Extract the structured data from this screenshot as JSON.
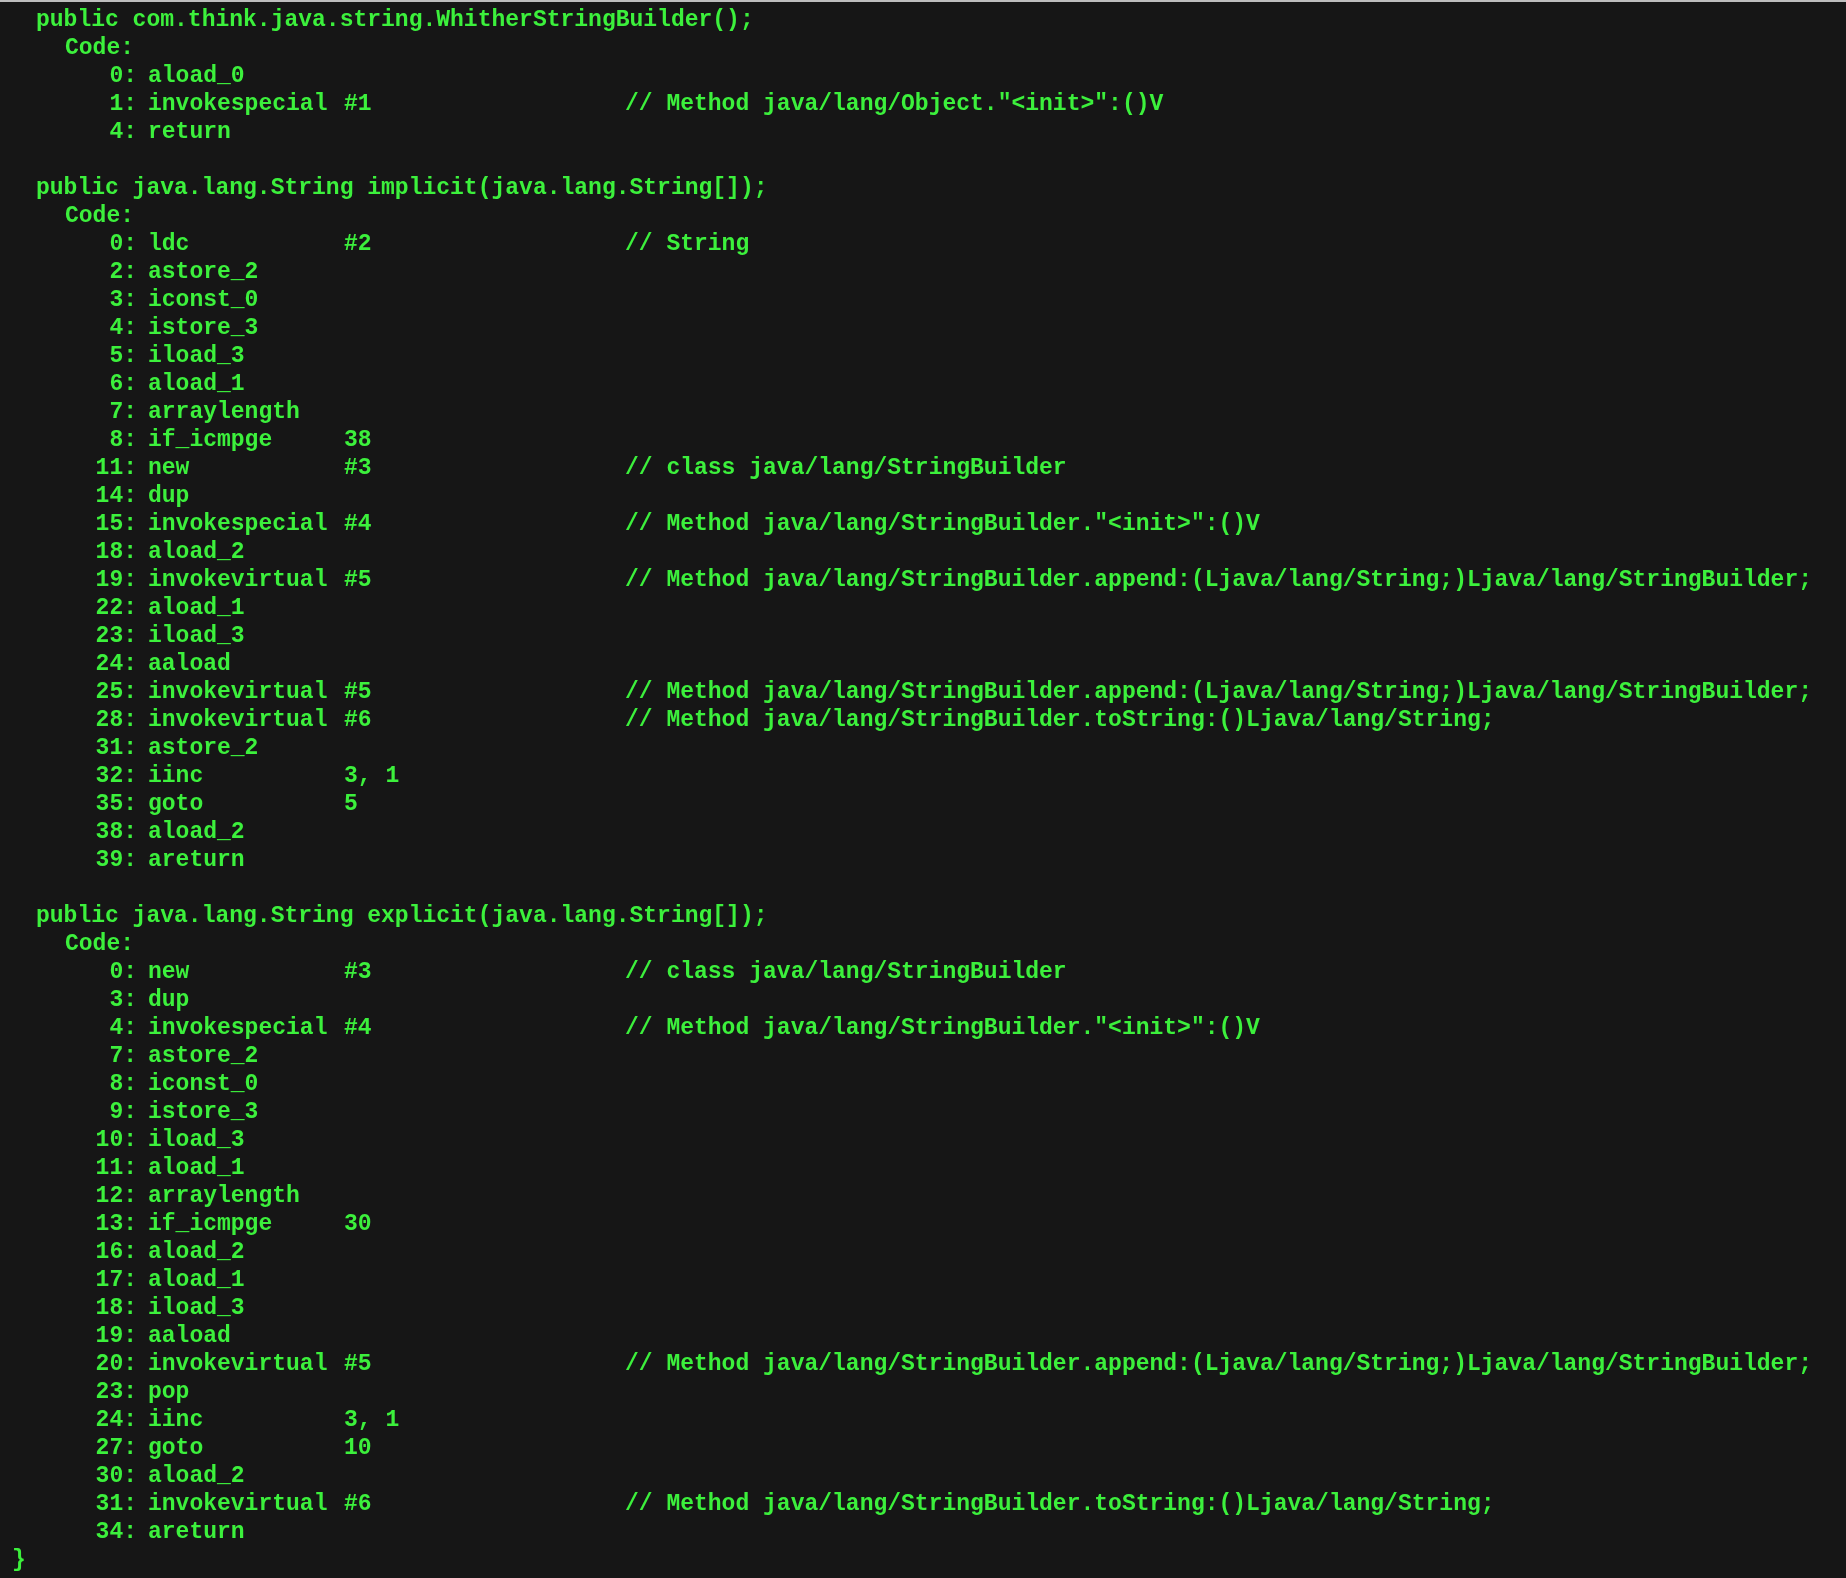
{
  "methods": [
    {
      "signature": "public com.think.java.string.WhitherStringBuilder();",
      "code_label": "Code:",
      "instructions": [
        {
          "offset": "0:",
          "opcode": "aload_0"
        },
        {
          "offset": "1:",
          "opcode": "invokespecial",
          "operand": "#1",
          "comment": "// Method java/lang/Object.\"<init>\":()V"
        },
        {
          "offset": "4:",
          "opcode": "return"
        }
      ]
    },
    {
      "signature": "public java.lang.String implicit(java.lang.String[]);",
      "code_label": "Code:",
      "instructions": [
        {
          "offset": "0:",
          "opcode": "ldc",
          "operand": "#2",
          "comment": "// String"
        },
        {
          "offset": "2:",
          "opcode": "astore_2"
        },
        {
          "offset": "3:",
          "opcode": "iconst_0"
        },
        {
          "offset": "4:",
          "opcode": "istore_3"
        },
        {
          "offset": "5:",
          "opcode": "iload_3"
        },
        {
          "offset": "6:",
          "opcode": "aload_1"
        },
        {
          "offset": "7:",
          "opcode": "arraylength"
        },
        {
          "offset": "8:",
          "opcode": "if_icmpge",
          "operand": "38"
        },
        {
          "offset": "11:",
          "opcode": "new",
          "operand": "#3",
          "comment": "// class java/lang/StringBuilder"
        },
        {
          "offset": "14:",
          "opcode": "dup"
        },
        {
          "offset": "15:",
          "opcode": "invokespecial",
          "operand": "#4",
          "comment": "// Method java/lang/StringBuilder.\"<init>\":()V"
        },
        {
          "offset": "18:",
          "opcode": "aload_2"
        },
        {
          "offset": "19:",
          "opcode": "invokevirtual",
          "operand": "#5",
          "comment": "// Method java/lang/StringBuilder.append:(Ljava/lang/String;)Ljava/lang/StringBuilder;"
        },
        {
          "offset": "22:",
          "opcode": "aload_1"
        },
        {
          "offset": "23:",
          "opcode": "iload_3"
        },
        {
          "offset": "24:",
          "opcode": "aaload"
        },
        {
          "offset": "25:",
          "opcode": "invokevirtual",
          "operand": "#5",
          "comment": "// Method java/lang/StringBuilder.append:(Ljava/lang/String;)Ljava/lang/StringBuilder;"
        },
        {
          "offset": "28:",
          "opcode": "invokevirtual",
          "operand": "#6",
          "comment": "// Method java/lang/StringBuilder.toString:()Ljava/lang/String;"
        },
        {
          "offset": "31:",
          "opcode": "astore_2"
        },
        {
          "offset": "32:",
          "opcode": "iinc",
          "operand": "3, 1"
        },
        {
          "offset": "35:",
          "opcode": "goto",
          "operand": "5"
        },
        {
          "offset": "38:",
          "opcode": "aload_2"
        },
        {
          "offset": "39:",
          "opcode": "areturn"
        }
      ]
    },
    {
      "signature": "public java.lang.String explicit(java.lang.String[]);",
      "code_label": "Code:",
      "instructions": [
        {
          "offset": "0:",
          "opcode": "new",
          "operand": "#3",
          "comment": "// class java/lang/StringBuilder"
        },
        {
          "offset": "3:",
          "opcode": "dup"
        },
        {
          "offset": "4:",
          "opcode": "invokespecial",
          "operand": "#4",
          "comment": "// Method java/lang/StringBuilder.\"<init>\":()V"
        },
        {
          "offset": "7:",
          "opcode": "astore_2"
        },
        {
          "offset": "8:",
          "opcode": "iconst_0"
        },
        {
          "offset": "9:",
          "opcode": "istore_3"
        },
        {
          "offset": "10:",
          "opcode": "iload_3"
        },
        {
          "offset": "11:",
          "opcode": "aload_1"
        },
        {
          "offset": "12:",
          "opcode": "arraylength"
        },
        {
          "offset": "13:",
          "opcode": "if_icmpge",
          "operand": "30"
        },
        {
          "offset": "16:",
          "opcode": "aload_2"
        },
        {
          "offset": "17:",
          "opcode": "aload_1"
        },
        {
          "offset": "18:",
          "opcode": "iload_3"
        },
        {
          "offset": "19:",
          "opcode": "aaload"
        },
        {
          "offset": "20:",
          "opcode": "invokevirtual",
          "operand": "#5",
          "comment": "// Method java/lang/StringBuilder.append:(Ljava/lang/String;)Ljava/lang/StringBuilder;"
        },
        {
          "offset": "23:",
          "opcode": "pop"
        },
        {
          "offset": "24:",
          "opcode": "iinc",
          "operand": "3, 1"
        },
        {
          "offset": "27:",
          "opcode": "goto",
          "operand": "10"
        },
        {
          "offset": "30:",
          "opcode": "aload_2"
        },
        {
          "offset": "31:",
          "opcode": "invokevirtual",
          "operand": "#6",
          "comment": "// Method java/lang/StringBuilder.toString:()Ljava/lang/String;"
        },
        {
          "offset": "34:",
          "opcode": "areturn"
        }
      ]
    }
  ],
  "closing_brace": "}"
}
